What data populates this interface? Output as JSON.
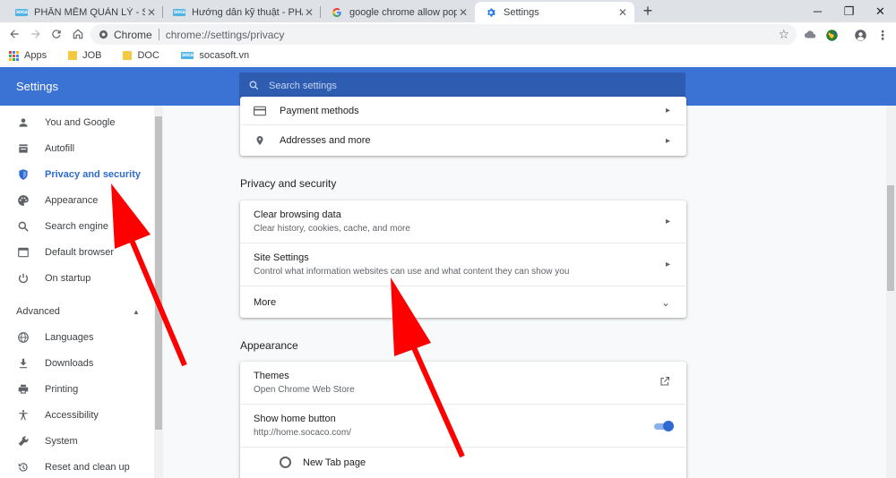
{
  "tabs": [
    {
      "title": "PHẦN MỀM QUẢN LÝ - SOCACO",
      "icon": "socaco-favicon",
      "favicon_text": "soca"
    },
    {
      "title": "Hướng dẫn kỹ thuật - PHẦN MỀM",
      "icon": "socaco-favicon",
      "favicon_text": "soca"
    },
    {
      "title": "google chrome allow pop ups - G",
      "icon": "google-favicon"
    },
    {
      "title": "Settings",
      "icon": "gear-icon",
      "active": true
    }
  ],
  "toolbar": {
    "chip_label": "Chrome",
    "url": "chrome://settings/privacy"
  },
  "bookmarks": [
    {
      "label": "Apps",
      "icon": "apps-grid-icon"
    },
    {
      "label": "JOB",
      "icon": "folder-icon"
    },
    {
      "label": "DOC",
      "icon": "folder-icon"
    },
    {
      "label": "socasoft.vn",
      "icon": "socaco-favicon",
      "favicon_text": "soca"
    }
  ],
  "header": {
    "title": "Settings",
    "search_placeholder": "Search settings"
  },
  "sidebar": {
    "items": [
      {
        "label": "You and Google",
        "icon": "person-icon"
      },
      {
        "label": "Autofill",
        "icon": "autofill-icon"
      },
      {
        "label": "Privacy and security",
        "icon": "shield-icon",
        "active": true
      },
      {
        "label": "Appearance",
        "icon": "palette-icon"
      },
      {
        "label": "Search engine",
        "icon": "search-icon"
      },
      {
        "label": "Default browser",
        "icon": "browser-icon"
      },
      {
        "label": "On startup",
        "icon": "power-icon"
      }
    ],
    "advanced_label": "Advanced",
    "advanced_items": [
      {
        "label": "Languages",
        "icon": "globe-icon"
      },
      {
        "label": "Downloads",
        "icon": "download-icon"
      },
      {
        "label": "Printing",
        "icon": "printer-icon"
      },
      {
        "label": "Accessibility",
        "icon": "accessibility-icon"
      },
      {
        "label": "System",
        "icon": "wrench-icon"
      },
      {
        "label": "Reset and clean up",
        "icon": "history-icon"
      }
    ]
  },
  "autofill_card": {
    "rows": [
      {
        "label": "Payment methods",
        "icon": "credit-card-icon"
      },
      {
        "label": "Addresses and more",
        "icon": "location-pin-icon"
      }
    ]
  },
  "privacy_section": {
    "title": "Privacy and security",
    "rows": [
      {
        "label": "Clear browsing data",
        "sub": "Clear history, cookies, cache, and more"
      },
      {
        "label": "Site Settings",
        "sub": "Control what information websites can use and what content they can show you"
      },
      {
        "label": "More"
      }
    ]
  },
  "appearance_section": {
    "title": "Appearance",
    "themes_label": "Themes",
    "themes_sub": "Open Chrome Web Store",
    "home_button_label": "Show home button",
    "home_button_sub": "http://home.socaco.com/",
    "home_button_enabled": true,
    "new_tab_label": "New Tab page"
  },
  "colors": {
    "header_blue": "#3b73d4",
    "active_blue": "#2f6ad0",
    "annotation_red": "#ff0000"
  }
}
